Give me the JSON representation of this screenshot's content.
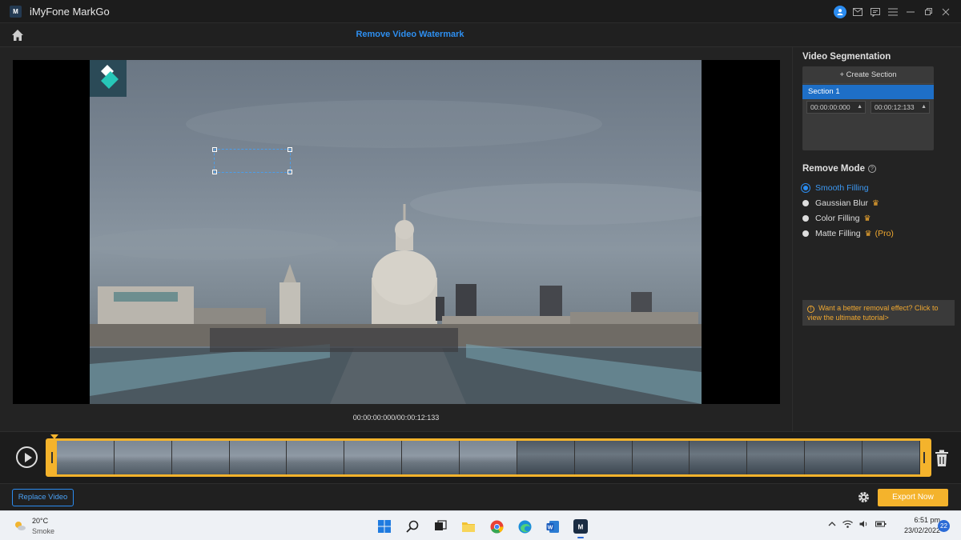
{
  "window": {
    "app_title": "iMyFone MarkGo",
    "logo_text": "M"
  },
  "header": {
    "page_title": "Remove Video Watermark"
  },
  "preview": {
    "timecode": "00:00:00:000/00:00:12:133"
  },
  "segmentation": {
    "heading": "Video Segmentation",
    "create_label": "+ Create Section",
    "section_label": "Section 1",
    "start_time": "00:00:00:000",
    "end_time": "00:00:12:133"
  },
  "remove_mode": {
    "heading": "Remove Mode",
    "options": [
      {
        "label": "Smooth Filling",
        "selected": true,
        "premium": false
      },
      {
        "label": "Gaussian Blur",
        "selected": false,
        "premium": true
      },
      {
        "label": "Color Filling",
        "selected": false,
        "premium": true
      },
      {
        "label": "Matte Filling",
        "selected": false,
        "premium": true,
        "pro_tag": "(Pro)"
      }
    ],
    "tip_text": "Want a better removal effect? Click to view the ultimate tutorial>"
  },
  "bottom": {
    "replace_label": "Replace Video",
    "export_label": "Export Now"
  },
  "taskbar": {
    "temperature": "20°C",
    "weather": "Smoke",
    "time": "6:51 pm",
    "date": "23/02/2022",
    "notifications": "22",
    "apps": [
      "windows-start",
      "search",
      "task-view",
      "file-explorer",
      "chrome",
      "edge",
      "word",
      "markgo"
    ]
  },
  "colors": {
    "accent_blue": "#2b8cf0",
    "accent_orange": "#f4b32c",
    "background": "#1e1e1e"
  },
  "icons": [
    "home-icon",
    "user-icon",
    "mail-icon",
    "feedback-icon",
    "menu-icon",
    "minimize-icon",
    "maximize-icon",
    "close-icon",
    "help-icon",
    "crown-icon",
    "info-icon",
    "play-icon",
    "trash-icon",
    "gear-icon",
    "weather-icon"
  ]
}
